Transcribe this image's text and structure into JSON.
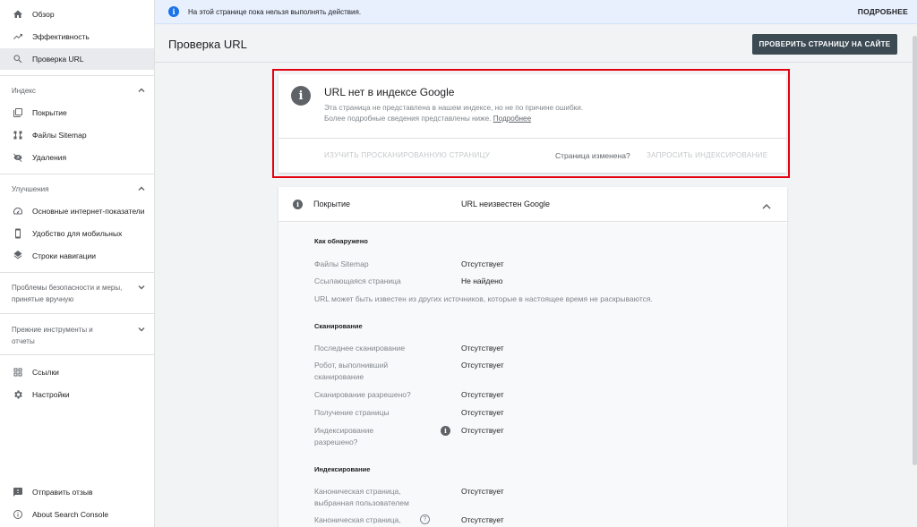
{
  "sidebar": {
    "items": [
      {
        "label": "Обзор",
        "icon": "home-icon"
      },
      {
        "label": "Эффективность",
        "icon": "trending-up-icon"
      },
      {
        "label": "Проверка URL",
        "icon": "search-icon"
      }
    ],
    "index_section": {
      "title": "Индекс",
      "items": [
        {
          "label": "Покрытие",
          "icon": "coverage-icon"
        },
        {
          "label": "Файлы Sitemap",
          "icon": "sitemap-icon"
        },
        {
          "label": "Удаления",
          "icon": "eye-off-icon"
        }
      ]
    },
    "enhancements_section": {
      "title": "Улучшения",
      "items": [
        {
          "label": "Основные интернет-показатели",
          "icon": "speedometer-icon"
        },
        {
          "label": "Удобство для мобильных",
          "icon": "phone-icon"
        },
        {
          "label": "Строки навигации",
          "icon": "layers-icon"
        }
      ]
    },
    "security_section": {
      "title": "Проблемы безопасности и меры, принятые вручную"
    },
    "legacy_section": {
      "title": "Прежние инструменты и отчеты"
    },
    "bottom_items": [
      {
        "label": "Ссылки",
        "icon": "links-icon"
      },
      {
        "label": "Настройки",
        "icon": "gear-icon"
      }
    ],
    "footer_items": [
      {
        "label": "Отправить отзыв",
        "icon": "feedback-icon"
      },
      {
        "label": "About Search Console",
        "icon": "info-icon"
      }
    ]
  },
  "banner": {
    "message": "На этой странице пока нельзя выполнять действия.",
    "more_label": "ПОДРОБНЕЕ"
  },
  "header": {
    "title": "Проверка URL",
    "test_button": "ПРОВЕРИТЬ СТРАНИЦУ НА САЙТЕ"
  },
  "status": {
    "title": "URL нет в индексе Google",
    "desc_line1": "Эта страница не представлена в нашем индексе, но не по причине ошибки.",
    "desc_line2": "Более подробные сведения представлены ниже.",
    "desc_link": "Подробнее",
    "action_view": "ИЗУЧИТЬ ПРОСКАНИРОВАННУЮ СТРАНИЦУ",
    "changed_q": "Страница изменена?",
    "action_request": "ЗАПРОСИТЬ ИНДЕКСИРОВАНИЕ"
  },
  "coverage": {
    "label": "Покрытие",
    "value": "URL неизвестен Google",
    "discovery": {
      "title": "Как обнаружено",
      "rows": [
        {
          "k": "Файлы Sitemap",
          "v": "Отсутствует"
        },
        {
          "k": "Ссылающаяся страница",
          "v": "Не найдено"
        }
      ],
      "note": "URL может быть известен из других источников, которые в настоящее время не раскрываются."
    },
    "crawl": {
      "title": "Сканирование",
      "rows": [
        {
          "k": "Последнее сканирование",
          "v": "Отсутствует"
        },
        {
          "k": "Робот, выполнивший сканирование",
          "v": "Отсутствует"
        },
        {
          "k": "Сканирование разрешено?",
          "v": "Отсутствует"
        },
        {
          "k": "Получение страницы",
          "v": "Отсутствует"
        },
        {
          "k": "Индексирование разрешено?",
          "v": "Отсутствует"
        }
      ]
    },
    "indexing": {
      "title": "Индексирование",
      "rows": [
        {
          "k": "Каноническая страница, выбранная пользователем",
          "v": "Отсутствует"
        },
        {
          "k": "Каноническая страница,",
          "v": "Отсутствует"
        }
      ]
    }
  },
  "colors": {
    "highlight": "#e3000f",
    "banner_bg": "#e8f0fe",
    "button_bg": "#3c4a54"
  }
}
